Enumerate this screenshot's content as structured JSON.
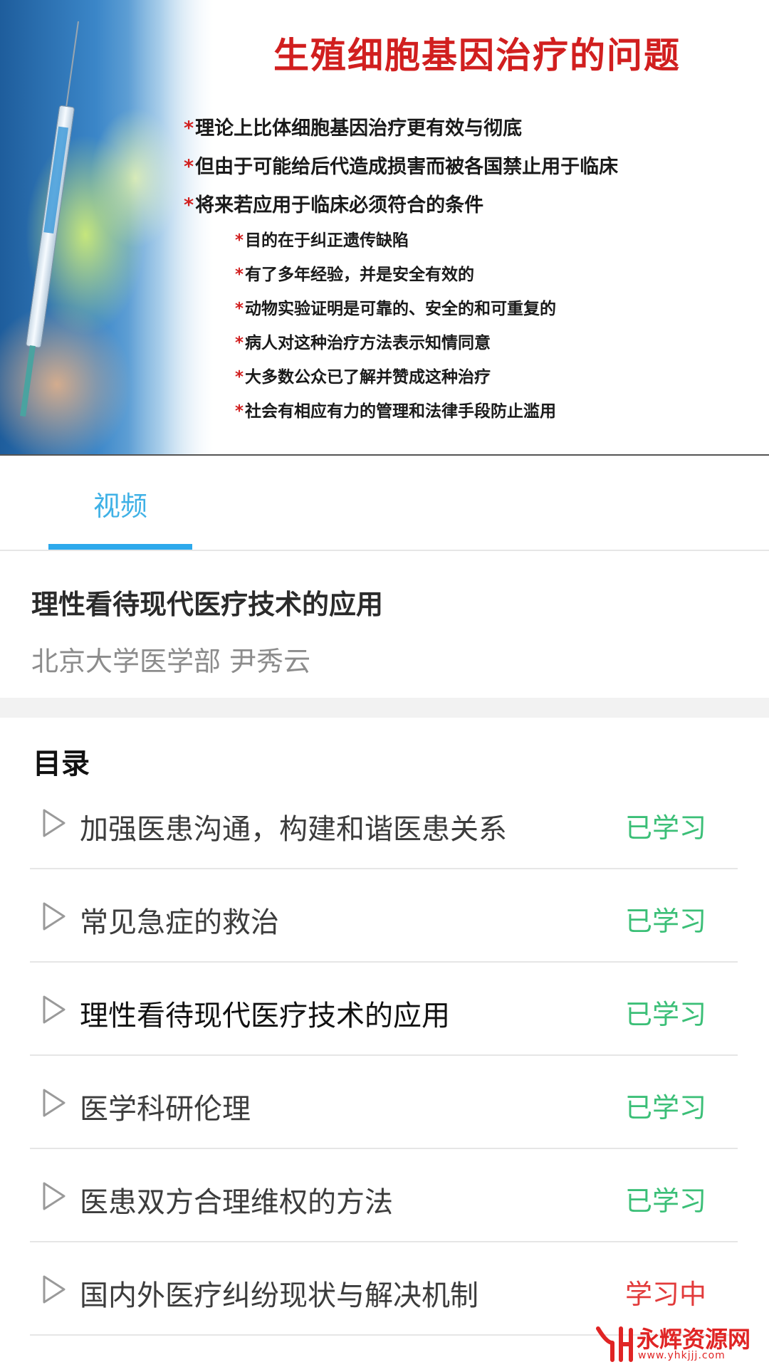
{
  "video": {
    "slide_title": "生殖细胞基因治疗的问题",
    "bullets": [
      "理论上比体细胞基因治疗更有效与彻底",
      "但由于可能给后代造成损害而被各国禁止用于临床",
      "将来若应用于临床必须符合的条件"
    ],
    "sub_bullets": [
      "目的在于纠正遗传缺陷",
      "有了多年经验，并是安全有效的",
      "动物实验证明是可靠的、安全的和可重复的",
      "病人对这种治疗方法表示知情同意",
      "大多数公众已了解并赞成这种治疗",
      "社会有相应有力的管理和法律手段防止滥用"
    ],
    "bullet_mark": "*"
  },
  "tabs": [
    {
      "label": "视频",
      "active": true
    }
  ],
  "course": {
    "title": "理性看待现代医疗技术的应用",
    "author": "北京大学医学部 尹秀云"
  },
  "catalog": {
    "heading": "目录",
    "items": [
      {
        "title": "加强医患沟通，构建和谐医患关系",
        "status": "已学习"
      },
      {
        "title": "常见急症的救治",
        "status": "已学习"
      },
      {
        "title": "理性看待现代医疗技术的应用",
        "status": "已学习"
      },
      {
        "title": "医学科研伦理",
        "status": "已学习"
      },
      {
        "title": "医患双方合理维权的方法",
        "status": "已学习"
      },
      {
        "title": "国内外医疗纠纷现状与解决机制",
        "status": "学习中"
      }
    ]
  },
  "colors": {
    "accent": "#2da9ec",
    "learned": "#3bbf77",
    "learning": "#e23b3b",
    "slide_title": "#d11f1f"
  },
  "icons": {
    "play": "play-outline-icon",
    "logo": "yh-logo-icon"
  },
  "watermark": {
    "name": "永辉资源网",
    "url": "www.yhkjjj.com"
  }
}
